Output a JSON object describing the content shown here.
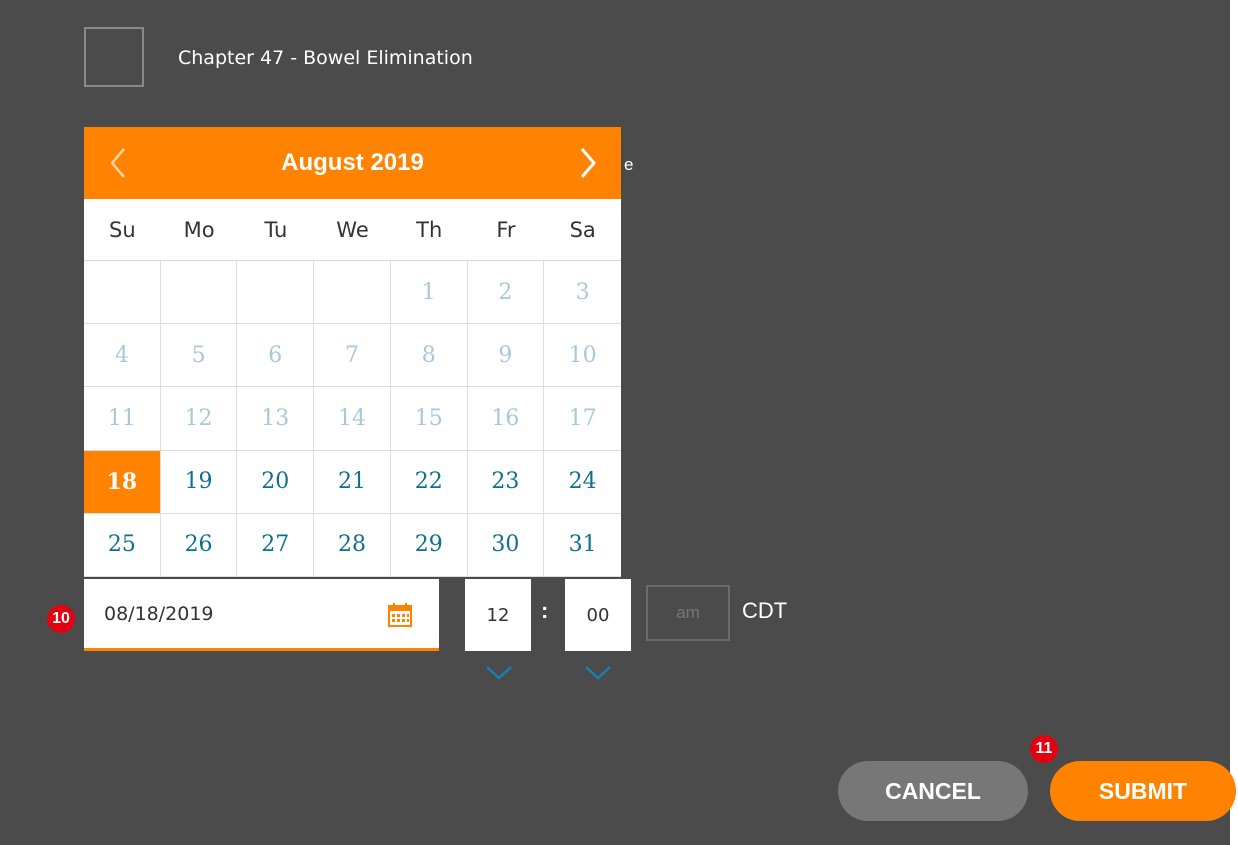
{
  "chapter": {
    "label": "Chapter 47 - Bowel Elimination"
  },
  "peek_text": "e",
  "calendar": {
    "month_title": "August 2019",
    "weekdays": [
      "Su",
      "Mo",
      "Tu",
      "We",
      "Th",
      "Fr",
      "Sa"
    ],
    "weeks": [
      [
        "",
        "",
        "",
        "",
        "1",
        "2",
        "3"
      ],
      [
        "4",
        "5",
        "6",
        "7",
        "8",
        "9",
        "10"
      ],
      [
        "11",
        "12",
        "13",
        "14",
        "15",
        "16",
        "17"
      ],
      [
        "18",
        "19",
        "20",
        "21",
        "22",
        "23",
        "24"
      ],
      [
        "25",
        "26",
        "27",
        "28",
        "29",
        "30",
        "31"
      ]
    ],
    "selected_day": "18",
    "past_days_up_to": 17
  },
  "date_field": {
    "value": "08/18/2019",
    "icon": "calendar-icon"
  },
  "time": {
    "hour": "12",
    "separator": ":",
    "minute": "00",
    "ampm": "am",
    "timezone": "CDT"
  },
  "badges": {
    "date": "10",
    "submit": "11"
  },
  "buttons": {
    "cancel": "CANCEL",
    "submit": "SUBMIT"
  },
  "colors": {
    "accent": "#ff8200",
    "panel": "#4b4b4b",
    "link": "#0e6f8f",
    "badge": "#e3000f"
  }
}
